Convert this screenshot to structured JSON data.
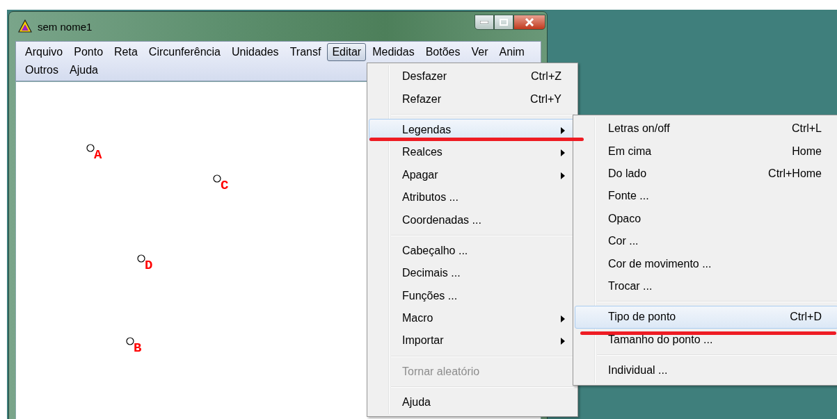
{
  "window": {
    "title": "sem nome1"
  },
  "menu_bar": [
    {
      "label": "Arquivo",
      "selected": false
    },
    {
      "label": "Ponto",
      "selected": false
    },
    {
      "label": "Reta",
      "selected": false
    },
    {
      "label": "Circunferência",
      "selected": false
    },
    {
      "label": "Unidades",
      "selected": false
    },
    {
      "label": "Transf",
      "selected": false
    },
    {
      "label": "Editar",
      "selected": true
    },
    {
      "label": "Medidas",
      "selected": false
    },
    {
      "label": "Botões",
      "selected": false
    },
    {
      "label": "Ver",
      "selected": false
    },
    {
      "label": "Anim",
      "selected": false
    },
    {
      "label": "Outros",
      "selected": false
    },
    {
      "label": "Ajuda",
      "selected": false
    }
  ],
  "canvas": {
    "points": [
      {
        "label": "A"
      },
      {
        "label": "C"
      },
      {
        "label": "D"
      },
      {
        "label": "B"
      }
    ]
  },
  "edit_menu": [
    {
      "kind": "item",
      "label": "Desfazer",
      "shortcut": "Ctrl+Z",
      "submenu": false,
      "disabled": false,
      "selected": false
    },
    {
      "kind": "item",
      "label": "Refazer",
      "shortcut": "Ctrl+Y",
      "submenu": false,
      "disabled": false,
      "selected": false
    },
    {
      "kind": "separator"
    },
    {
      "kind": "item",
      "label": "Legendas",
      "submenu": true,
      "disabled": false,
      "selected": true
    },
    {
      "kind": "item",
      "label": "Realces",
      "submenu": true,
      "disabled": false,
      "selected": false
    },
    {
      "kind": "item",
      "label": "Apagar",
      "submenu": true,
      "disabled": false,
      "selected": false
    },
    {
      "kind": "item",
      "label": "Atributos ...",
      "submenu": false,
      "disabled": false,
      "selected": false
    },
    {
      "kind": "item",
      "label": "Coordenadas ...",
      "submenu": false,
      "disabled": false,
      "selected": false
    },
    {
      "kind": "separator"
    },
    {
      "kind": "item",
      "label": "Cabeçalho ...",
      "submenu": false,
      "disabled": false,
      "selected": false
    },
    {
      "kind": "item",
      "label": "Decimais ...",
      "submenu": false,
      "disabled": false,
      "selected": false
    },
    {
      "kind": "item",
      "label": "Funções ...",
      "submenu": false,
      "disabled": false,
      "selected": false
    },
    {
      "kind": "item",
      "label": "Macro",
      "submenu": true,
      "disabled": false,
      "selected": false
    },
    {
      "kind": "item",
      "label": "Importar",
      "submenu": true,
      "disabled": false,
      "selected": false
    },
    {
      "kind": "separator"
    },
    {
      "kind": "item",
      "label": "Tornar aleatório",
      "submenu": false,
      "disabled": true,
      "selected": false
    },
    {
      "kind": "separator"
    },
    {
      "kind": "item",
      "label": "Ajuda",
      "submenu": false,
      "disabled": false,
      "selected": false
    }
  ],
  "legendas_submenu": [
    {
      "kind": "item",
      "label": "Letras on/off",
      "shortcut": "Ctrl+L",
      "submenu": false,
      "disabled": false,
      "selected": false
    },
    {
      "kind": "item",
      "label": "Em cima",
      "shortcut": "Home",
      "submenu": false,
      "disabled": false,
      "selected": false
    },
    {
      "kind": "item",
      "label": "Do lado",
      "shortcut": "Ctrl+Home",
      "submenu": false,
      "disabled": false,
      "selected": false
    },
    {
      "kind": "item",
      "label": "Fonte ...",
      "submenu": false,
      "disabled": false,
      "selected": false
    },
    {
      "kind": "item",
      "label": "Opaco",
      "submenu": false,
      "disabled": false,
      "selected": false
    },
    {
      "kind": "item",
      "label": "Cor ...",
      "submenu": false,
      "disabled": false,
      "selected": false
    },
    {
      "kind": "item",
      "label": "Cor de movimento ...",
      "submenu": false,
      "disabled": false,
      "selected": false
    },
    {
      "kind": "item",
      "label": "Trocar ...",
      "submenu": false,
      "disabled": false,
      "selected": false
    },
    {
      "kind": "separator"
    },
    {
      "kind": "item",
      "label": "Tipo de ponto",
      "shortcut": "Ctrl+D",
      "submenu": false,
      "disabled": false,
      "selected": true
    },
    {
      "kind": "item",
      "label": "Tamanho do ponto ...",
      "submenu": false,
      "disabled": false,
      "selected": false
    },
    {
      "kind": "separator"
    },
    {
      "kind": "item",
      "label": "Individual ...",
      "submenu": false,
      "disabled": false,
      "selected": false
    }
  ]
}
